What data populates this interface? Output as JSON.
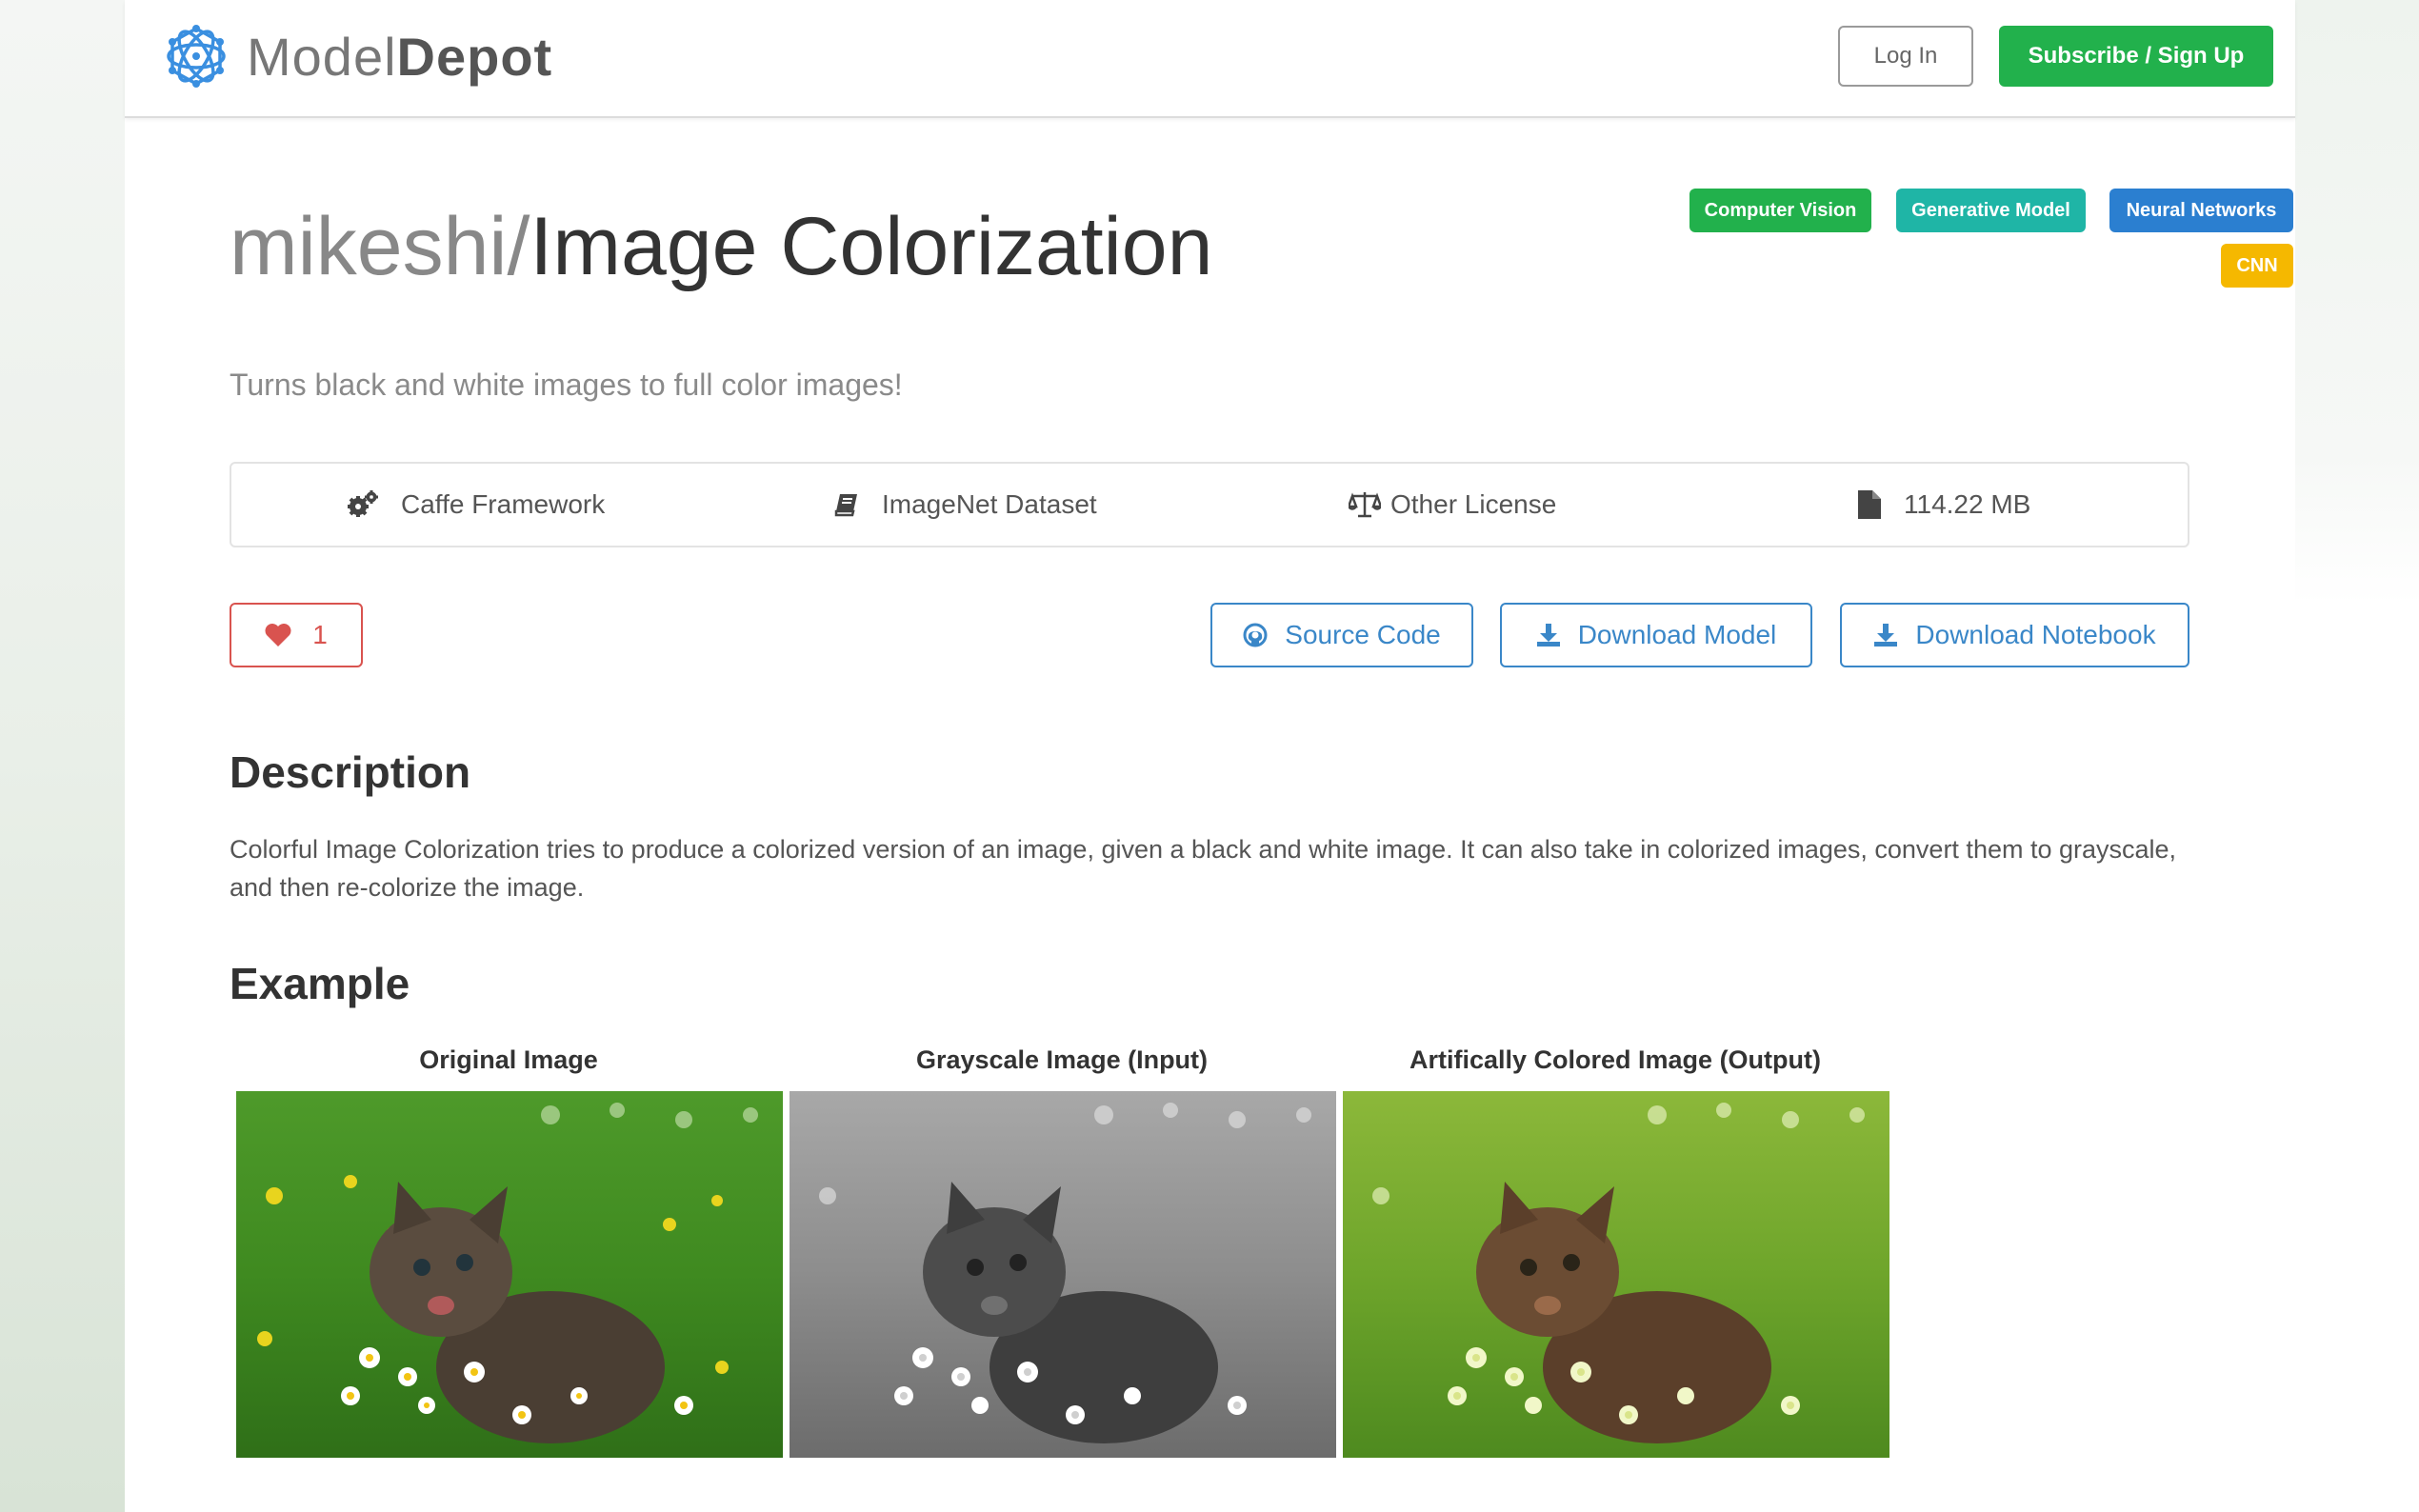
{
  "header": {
    "brand": {
      "name_light": "Model",
      "name_bold": "Depot"
    },
    "login_label": "Log In",
    "signup_label": "Subscribe / Sign Up"
  },
  "model": {
    "owner": "mikeshi",
    "separator": "/",
    "name": "Image Colorization",
    "tagline": "Turns black and white images to full color images!",
    "tags": [
      {
        "label": "Computer Vision",
        "color": "#22b14c"
      },
      {
        "label": "Generative Model",
        "color": "#1fb5a6"
      },
      {
        "label": "Neural Networks",
        "color": "#2b7fd0"
      },
      {
        "label": "CNN",
        "color": "#f5b800"
      }
    ]
  },
  "info": {
    "framework": "Caffe Framework",
    "dataset": "ImageNet Dataset",
    "license": "Other License",
    "size": "114.22 MB"
  },
  "actions": {
    "likes": "1",
    "source_code": "Source Code",
    "download_model": "Download Model",
    "download_notebook": "Download Notebook"
  },
  "description": {
    "heading": "Description",
    "text": "Colorful Image Colorization tries to produce a colorized version of an image, given a black and white image. It can also take in colorized images, convert them to grayscale, and then re-colorize the image."
  },
  "example": {
    "heading": "Example",
    "images": [
      {
        "label": "Original Image"
      },
      {
        "label": "Grayscale Image (Input)"
      },
      {
        "label": "Artifically Colored Image (Output)"
      }
    ]
  },
  "colors": {
    "green": "#22b14c",
    "blue": "#3a87c8",
    "red": "#d9534f",
    "logo": "#3a8fe0"
  },
  "icons": [
    "network-logo-icon",
    "cogs-icon",
    "book-icon",
    "balance-scale-icon",
    "file-icon",
    "heart-icon",
    "github-icon",
    "download-icon"
  ]
}
